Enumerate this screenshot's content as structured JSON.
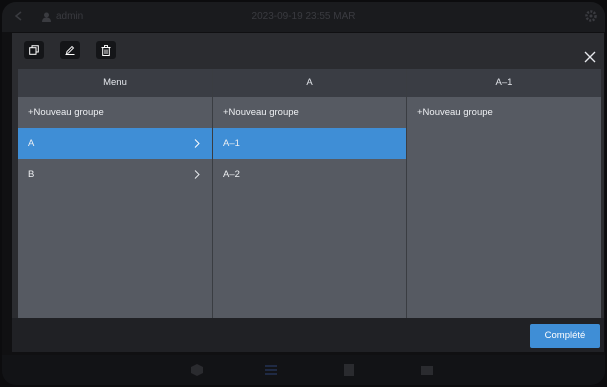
{
  "background": {
    "user_name": "admin",
    "datetime": "2023-09-19 23:55 MAR"
  },
  "toolbar": {
    "copy_icon": "copy-icon",
    "edit_icon": "pencil-icon",
    "delete_icon": "trash-icon",
    "close_icon": "close-icon"
  },
  "columns": [
    {
      "header": "Menu",
      "rows": [
        {
          "label": "+Nouveau groupe",
          "selected": false,
          "chevron": false
        },
        {
          "label": "A",
          "selected": true,
          "chevron": true
        },
        {
          "label": "B",
          "selected": false,
          "chevron": true
        }
      ]
    },
    {
      "header": "A",
      "rows": [
        {
          "label": "+Nouveau groupe",
          "selected": false,
          "chevron": false
        },
        {
          "label": "A–1",
          "selected": true,
          "chevron": false
        },
        {
          "label": "A–2",
          "selected": false,
          "chevron": false
        }
      ]
    },
    {
      "header": "A–1",
      "rows": [
        {
          "label": "+Nouveau groupe",
          "selected": false,
          "chevron": false
        }
      ]
    }
  ],
  "footer": {
    "done_label": "Complété"
  },
  "colors": {
    "accent": "#3f8ed6",
    "panel": "#565a62",
    "header": "#3a3d44",
    "modal": "#2b2c30"
  }
}
